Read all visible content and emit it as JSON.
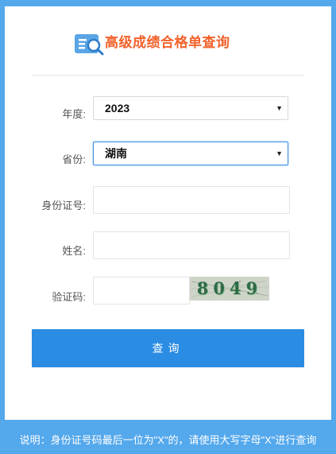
{
  "page": {
    "title": "高级成绩合格单查询",
    "accent_color": "#f2622b",
    "button_color": "#2b8ce3",
    "background_color": "#54a8ec"
  },
  "header": {
    "icon": "document-search-icon"
  },
  "form": {
    "year": {
      "label": "年度:",
      "value": "2023"
    },
    "province": {
      "label": "省份:",
      "value": "湖南"
    },
    "id_number": {
      "label": "身份证号:",
      "value": ""
    },
    "name": {
      "label": "姓名:",
      "value": ""
    },
    "captcha": {
      "label": "验证码:",
      "value": "",
      "image_text": "8049"
    },
    "submit_label": "查询"
  },
  "footer": {
    "note": "说明：身份证号码最后一位为\"X\"的，请使用大写字母\"X\"进行查询"
  }
}
